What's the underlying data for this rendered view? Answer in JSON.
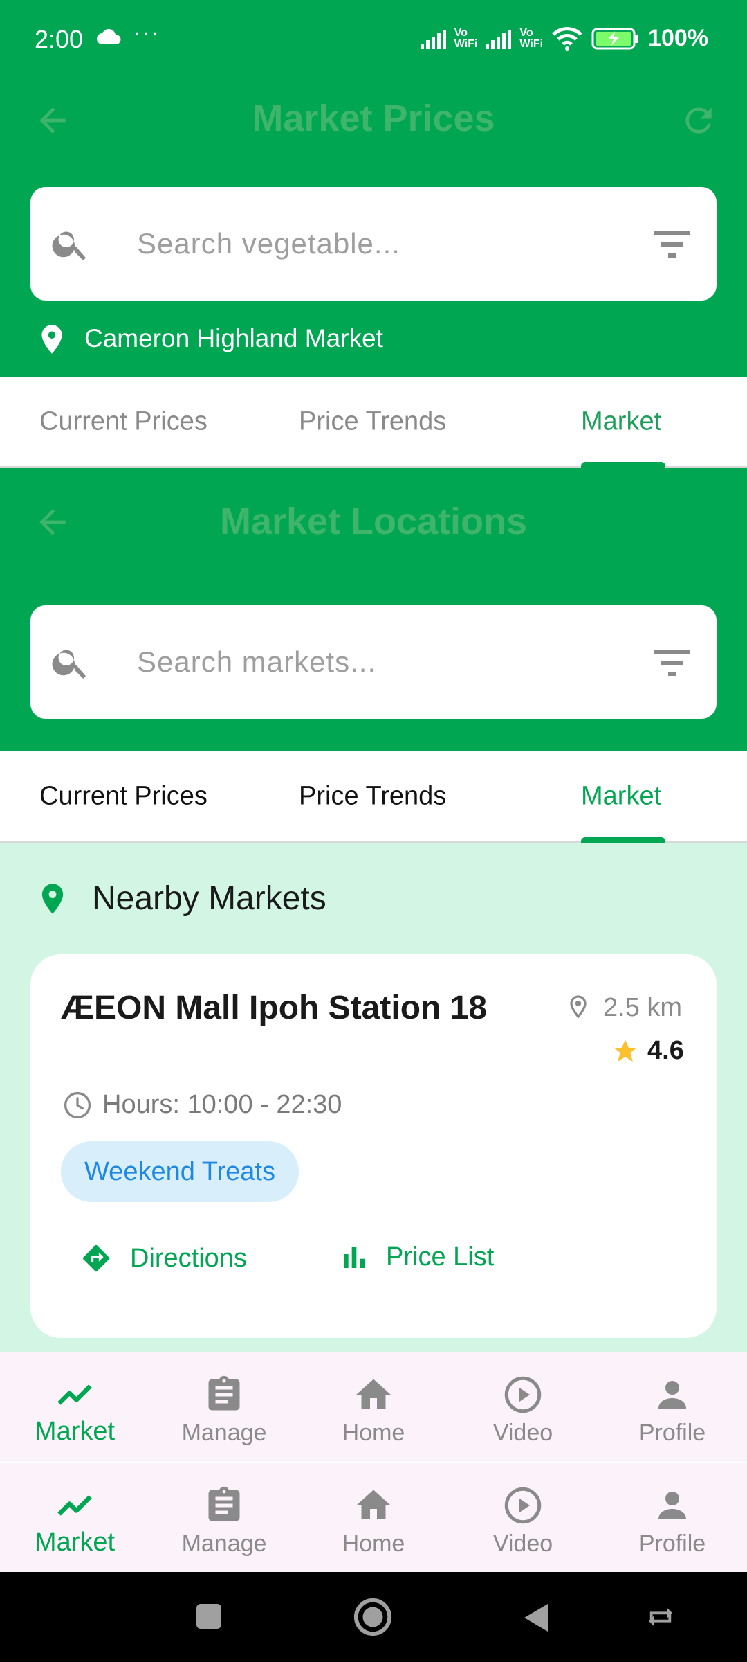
{
  "status_bar": {
    "time": "2:00",
    "dots": "···",
    "vo_label": "Vo",
    "wifi_label": "WiFi",
    "battery": "100%"
  },
  "header_prices": {
    "title": "Market Prices",
    "search_placeholder": "Search vegetable...",
    "location": "Cameron Highland Market"
  },
  "tabs": [
    "Current Prices",
    "Price Trends",
    "Market"
  ],
  "header_locations": {
    "title": "Market Locations",
    "search_placeholder": "Search markets..."
  },
  "nearby": {
    "heading": "Nearby Markets",
    "markets": [
      {
        "name": "ÆEON Mall Ipoh Station 18",
        "distance": "2.5 km",
        "rating": "4.6",
        "hours": "Hours: 10:00 - 22:30",
        "tag": "Weekend Treats",
        "directions_label": "Directions",
        "pricelist_label": "Price List"
      }
    ]
  },
  "bottom_nav": [
    "Market",
    "Manage",
    "Home",
    "Video",
    "Profile"
  ],
  "colors": {
    "primary": "#00A651",
    "faded_header_text": "#3FB56B",
    "content_bg": "#D2F5E4",
    "chip_bg": "#D9EEFB",
    "chip_text": "#1E88E5",
    "star": "#FBC02D",
    "nav_bg": "#FCF3FA"
  },
  "icons": [
    "back-arrow-icon",
    "refresh-icon",
    "search-icon",
    "filter-icon",
    "location-pin-icon",
    "clock-icon",
    "star-icon",
    "directions-icon",
    "bar-chart-icon",
    "trending-icon",
    "clipboard-icon",
    "home-icon",
    "play-circle-icon",
    "person-icon"
  ]
}
